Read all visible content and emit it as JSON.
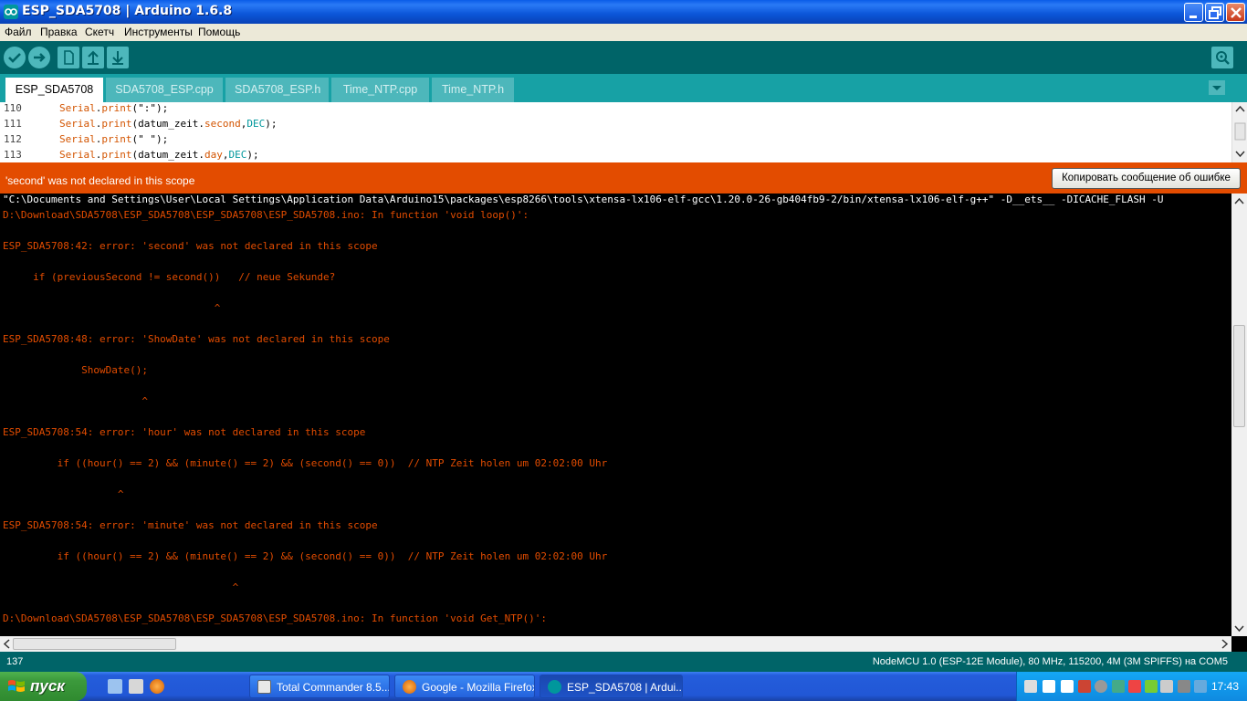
{
  "window": {
    "title": "ESP_SDA5708 | Arduino 1.6.8",
    "app_icon": "arduino-infinity-icon"
  },
  "menu": [
    "Файл",
    "Правка",
    "Скетч",
    "Инструменты",
    "Помощь"
  ],
  "toolbar": {
    "buttons": [
      "verify-icon",
      "upload-icon",
      "new-icon",
      "open-icon",
      "save-icon"
    ],
    "serial_monitor": "serial-monitor-icon"
  },
  "tabs": [
    "ESP_SDA5708",
    "SDA5708_ESP.cpp",
    "SDA5708_ESP.h",
    "Time_NTP.cpp",
    "Time_NTP.h"
  ],
  "editor": {
    "lines": [
      {
        "num": "110",
        "obj": "Serial",
        "fn": "print",
        "rest_pre": "(\":\");",
        "field": "",
        "arg": ""
      },
      {
        "num": "111",
        "obj": "Serial",
        "fn": "print",
        "rest_pre": "(datum_zeit.",
        "field": "second",
        "arg": "DEC"
      },
      {
        "num": "112",
        "obj": "Serial",
        "fn": "print",
        "rest_pre": "(\" \");",
        "field": "",
        "arg": ""
      },
      {
        "num": "113",
        "obj": "Serial",
        "fn": "print",
        "rest_pre": "(datum_zeit.",
        "field": "day",
        "arg": "DEC"
      }
    ]
  },
  "error": {
    "message": "'second' was not declared in this scope",
    "copy_button": "Копировать сообщение об ошибке"
  },
  "console": {
    "command": "\"C:\\Documents and Settings\\User\\Local Settings\\Application Data\\Arduino15\\packages\\esp8266\\tools\\xtensa-lx106-elf-gcc\\1.20.0-26-gb404fb9-2/bin/xtensa-lx106-elf-g++\" -D__ets__ -DICACHE_FLASH -U",
    "lines": [
      "D:\\Download\\SDA5708\\ESP_SDA5708\\ESP_SDA5708\\ESP_SDA5708.ino: In function 'void loop()':",
      "ESP_SDA5708:42: error: 'second' was not declared in this scope",
      "     if (previousSecond != second())   // neue Sekunde?",
      "                                   ^",
      "ESP_SDA5708:48: error: 'ShowDate' was not declared in this scope",
      "             ShowDate();",
      "                       ^",
      "ESP_SDA5708:54: error: 'hour' was not declared in this scope",
      "         if ((hour() == 2) && (minute() == 2) && (second() == 0))  // NTP Zeit holen um 02:02:00 Uhr",
      "                   ^",
      "ESP_SDA5708:54: error: 'minute' was not declared in this scope",
      "         if ((hour() == 2) && (minute() == 2) && (second() == 0))  // NTP Zeit holen um 02:02:00 Uhr",
      "                                      ^",
      "D:\\Download\\SDA5708\\ESP_SDA5708\\ESP_SDA5708\\ESP_SDA5708.ino: In function 'void Get_NTP()':"
    ]
  },
  "status": {
    "line": "137",
    "board": "NodeMCU 1.0 (ESP-12E Module), 80 MHz, 115200, 4M (3M SPIFFS) на COM5"
  },
  "taskbar": {
    "start_label": "пуск",
    "tasks": [
      {
        "label": "Total Commander 8.5...",
        "icon": "total-commander-icon"
      },
      {
        "label": "Google - Mozilla Firefox",
        "icon": "firefox-icon"
      },
      {
        "label": "ESP_SDA5708 | Ardui...",
        "icon": "arduino-infinity-icon"
      }
    ],
    "clock": "17:43"
  }
}
